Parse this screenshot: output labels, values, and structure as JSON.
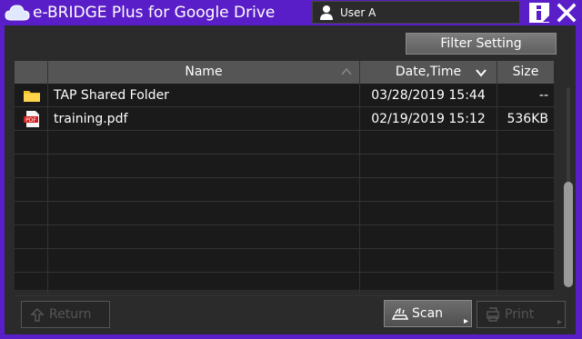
{
  "app": {
    "title": "e-BRIDGE Plus for Google Drive"
  },
  "user": {
    "name": "User A"
  },
  "toolbar": {
    "filter_label": "Filter Setting"
  },
  "table": {
    "columns": {
      "name": "Name",
      "datetime": "Date,Time",
      "size": "Size"
    },
    "rows": [
      {
        "icon": "folder-icon",
        "name": "TAP Shared Folder",
        "datetime": "03/28/2019 15:44",
        "size": "--"
      },
      {
        "icon": "pdf-icon",
        "pdf_badge": "PDF",
        "name": "training.pdf",
        "datetime": "02/19/2019 15:12",
        "size": "536KB"
      }
    ],
    "empty_rows": 7
  },
  "footer": {
    "return_label": "Return",
    "scan_label": "Scan",
    "print_label": "Print"
  },
  "colors": {
    "accent": "#5a1ec8",
    "panel": "#2b2b2b",
    "table_bg": "#1a1a1a",
    "header": "#555555"
  }
}
